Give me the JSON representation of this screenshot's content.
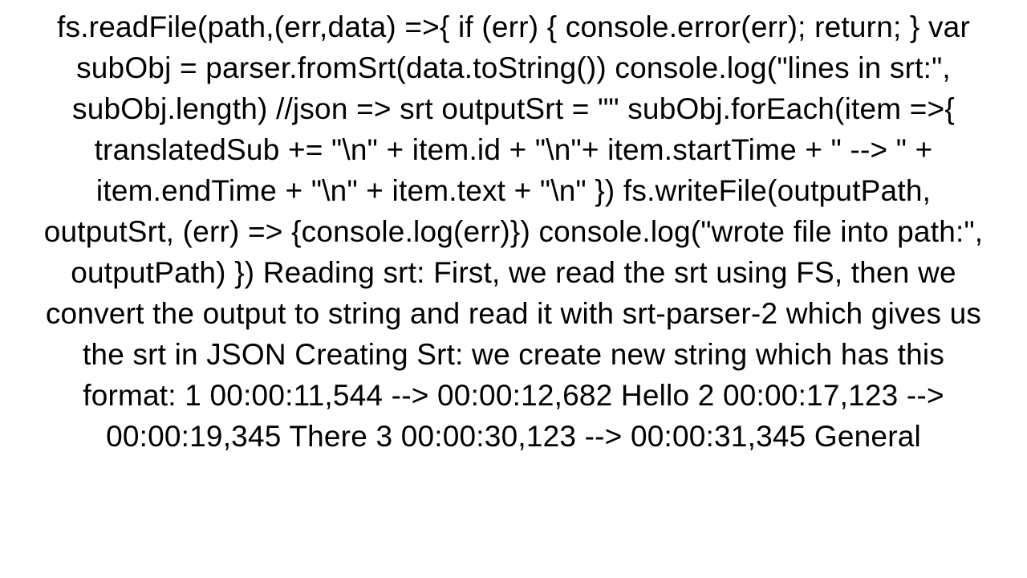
{
  "text": "fs.readFile(path,(err,data) =>{   if (err) {     console.error(err);     return;   }   var subObj = parser.fromSrt(data.toString())   console.log(\"lines in srt:\", subObj.length)   //json => srt   outputSrt = \"\" subObj.forEach(item =>{     translatedSub += \"\\n\" + item.id + \"\\n\"+ item.startTime + \" --> \" + item.endTime + \"\\n\" + item.text + \"\\n\"    })   fs.writeFile(outputPath, outputSrt, (err) => {console.log(err)})   console.log(\"wrote file into path:\", outputPath) })  Reading srt: First, we read the srt using FS, then we convert the output to string and read it with srt-parser-2 which gives us the srt in JSON Creating Srt: we create new string which has this format: 1 00:00:11,544 --> 00:00:12,682 Hello  2 00:00:17,123 --> 00:00:19,345 There  3 00:00:30,123 --> 00:00:31,345 General"
}
